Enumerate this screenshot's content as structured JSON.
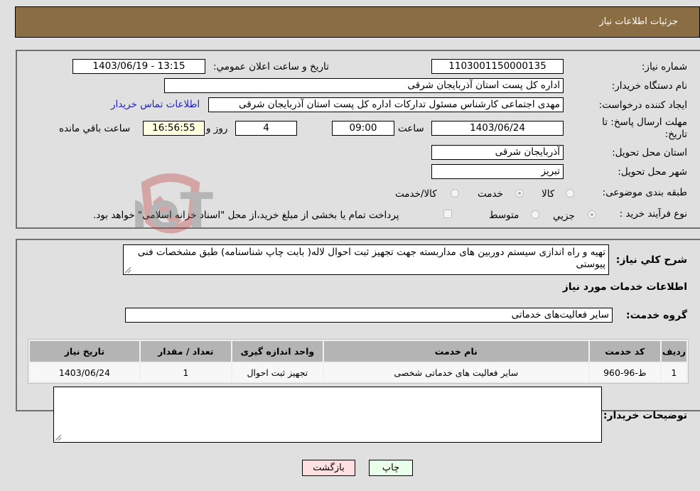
{
  "header": {
    "title": "جزئیات اطلاعات نیاز"
  },
  "form": {
    "need_number": {
      "label": "شماره نیاز:",
      "value": "1103001150000135"
    },
    "announce_datetime": {
      "label": "تاریخ و ساعت اعلان عمومي:",
      "value": "1403/06/19 - 13:15"
    },
    "buyer_org": {
      "label": "نام دستگاه خریدار:",
      "value": "اداره کل پست استان آذربایجان شرقی"
    },
    "requester": {
      "label": "ایجاد کننده درخواست:",
      "value": "مهدی اجتماعی کارشناس مسئول تدارکات اداره کل پست استان آذربایجان شرقی"
    },
    "buyer_contact_link": "اطلاعات تماس خریدار",
    "deadline": {
      "label": "مهلت ارسال پاسخ: تا تاریخ:",
      "date": "1403/06/24",
      "time_label": "ساعت",
      "time": "09:00",
      "days": "4",
      "days_label": "روز و",
      "remaining": "16:56:55",
      "remaining_label": "ساعت باقي مانده"
    },
    "delivery_province": {
      "label": "استان محل تحویل:",
      "value": "آذربایجان شرقی"
    },
    "delivery_city": {
      "label": "شهر محل تحویل:",
      "value": "تبریز"
    },
    "category": {
      "label": "طبقه بندی موضوعی:",
      "options": [
        "کالا",
        "خدمت",
        "کالا/خدمت"
      ],
      "selected": "خدمت"
    },
    "purchase_type": {
      "label": "نوع فرآیند خرید :",
      "options": [
        "جزيي",
        "متوسط"
      ],
      "selected": "جزيي",
      "note": "پرداخت تمام یا بخشی از مبلغ خرید،از محل \"اسناد خزانه اسلامی\" خواهد بود."
    }
  },
  "details": {
    "description_label": "شرح كلي نياز:",
    "description": "تهیه و راه اندازی سیستم دوربین های مداربسته جهت تجهیز ثبت احوال لاله( بابت چاپ شناسنامه) طبق مشخصات فنی پیوستی",
    "services_heading": "اطلاعات خدمات مورد نیاز",
    "service_group_label": "گروه خدمت:",
    "service_group": "سایر فعالیت‌های خدماتی",
    "table": {
      "headers": [
        "ردیف",
        "کد خدمت",
        "نام خدمت",
        "واحد اندازه گیری",
        "تعداد / مقدار",
        "تاریخ نیاز"
      ],
      "rows": [
        [
          "1",
          "ط-96-960",
          "سایر فعالیت های خدماتی شخصی",
          "تجهیز ثبت احوال",
          "1",
          "1403/06/24"
        ]
      ]
    },
    "buyer_notes_label": "توضیحات خریدار:",
    "buyer_notes": ""
  },
  "buttons": {
    "print": "چاپ",
    "back": "بازگشت"
  },
  "watermark": "AriaTender.neT",
  "colors": {
    "header_bg": "#8b6d43",
    "print_bg": "#eaffea",
    "back_bg": "#ffe0e0",
    "link": "#2020c0"
  }
}
